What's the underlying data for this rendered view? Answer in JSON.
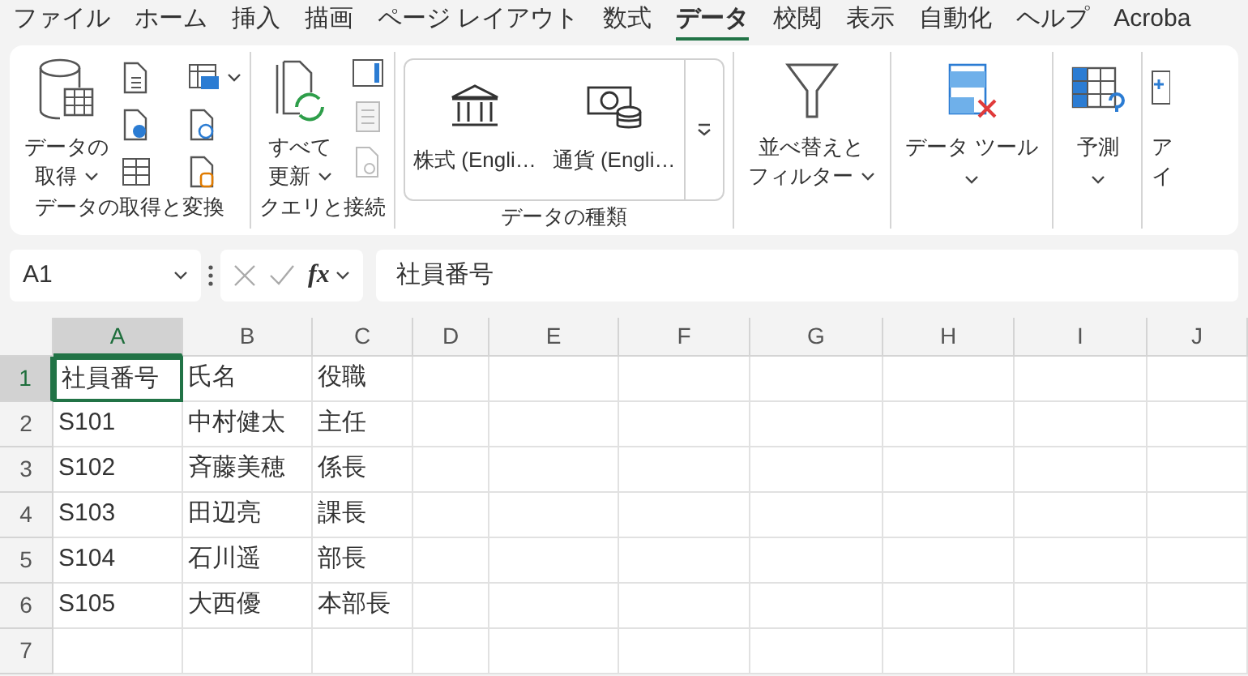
{
  "menu_tabs": [
    {
      "label": "ファイル",
      "selected": false
    },
    {
      "label": "ホーム",
      "selected": false
    },
    {
      "label": "挿入",
      "selected": false
    },
    {
      "label": "描画",
      "selected": false
    },
    {
      "label": "ページ レイアウト",
      "selected": false
    },
    {
      "label": "数式",
      "selected": false
    },
    {
      "label": "データ",
      "selected": true
    },
    {
      "label": "校閲",
      "selected": false
    },
    {
      "label": "表示",
      "selected": false
    },
    {
      "label": "自動化",
      "selected": false
    },
    {
      "label": "ヘルプ",
      "selected": false
    },
    {
      "label": "Acroba",
      "selected": false
    }
  ],
  "ribbon": {
    "groups": [
      {
        "kind": "get",
        "label": "データの取得と変換",
        "button": {
          "lines": [
            "データの",
            "取得"
          ],
          "dropdown": true
        }
      },
      {
        "kind": "queries",
        "label": "クエリと接続",
        "button": {
          "lines": [
            "すべて",
            "更新"
          ],
          "dropdown": true
        }
      },
      {
        "kind": "types",
        "label": "データの種類",
        "items": [
          "株式 (Engli…",
          "通貨 (Engli…"
        ]
      },
      {
        "kind": "sort",
        "button": {
          "lines": [
            "並べ替えと",
            "フィルター"
          ],
          "dropdown": true
        }
      },
      {
        "kind": "tools",
        "button": {
          "lines": [
            "データ ツール"
          ],
          "dropdown": true
        }
      },
      {
        "kind": "forecast",
        "button": {
          "lines": [
            "予測"
          ],
          "dropdown": true
        }
      },
      {
        "kind": "outline",
        "button": {
          "lines": [
            "ア",
            "イ"
          ],
          "dropdown": false
        }
      }
    ]
  },
  "name_box": "A1",
  "function_label": "fx",
  "formula": "社員番号",
  "sheet": {
    "columns": [
      {
        "label": "A",
        "selected": true
      },
      {
        "label": "B",
        "selected": false
      },
      {
        "label": "C",
        "selected": false
      },
      {
        "label": "D",
        "selected": false
      },
      {
        "label": "E",
        "selected": false
      },
      {
        "label": "F",
        "selected": false
      },
      {
        "label": "G",
        "selected": false
      },
      {
        "label": "H",
        "selected": false
      },
      {
        "label": "I",
        "selected": false
      },
      {
        "label": "J",
        "selected": false
      }
    ],
    "rows": [
      {
        "number": "1",
        "selected": true,
        "cells": [
          "社員番号",
          "氏名",
          "役職"
        ]
      },
      {
        "number": "2",
        "selected": false,
        "cells": [
          "S101",
          "中村健太",
          "主任"
        ]
      },
      {
        "number": "3",
        "selected": false,
        "cells": [
          "S102",
          "斉藤美穂",
          "係長"
        ]
      },
      {
        "number": "4",
        "selected": false,
        "cells": [
          "S103",
          "田辺亮",
          "課長"
        ]
      },
      {
        "number": "5",
        "selected": false,
        "cells": [
          "S104",
          "石川遥",
          "部長"
        ]
      },
      {
        "number": "6",
        "selected": false,
        "cells": [
          "S105",
          "大西優",
          "本部長"
        ]
      },
      {
        "number": "7",
        "selected": false,
        "cells": []
      }
    ]
  }
}
